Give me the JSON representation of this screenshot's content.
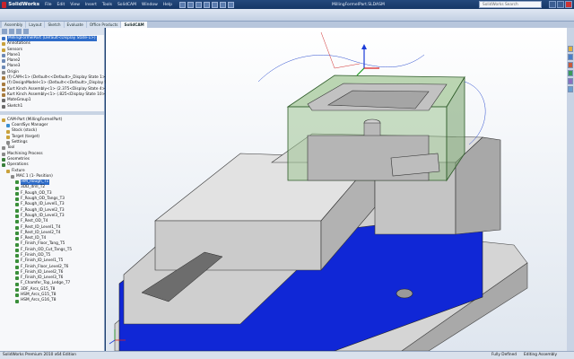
{
  "app": {
    "brand": "SolidWorks",
    "menu": [
      "File",
      "Edit",
      "View",
      "Insert",
      "Tools",
      "SolidCAM",
      "Window",
      "Help"
    ],
    "doc_title": "MillingFormelPart.SLDASM",
    "search_placeholder": "SolidWorks Search"
  },
  "tabs": [
    "Assembly",
    "Layout",
    "Sketch",
    "Evaluate",
    "Office Products",
    "SolidCAM"
  ],
  "feature_tree": [
    {
      "label": "MillingFormelPart (Default<Display State-1>)",
      "selected": true,
      "color": "#3a6fc1"
    },
    {
      "label": "Annotations",
      "color": "#c9a13b"
    },
    {
      "label": "Sensors",
      "color": "#c9a13b"
    },
    {
      "label": "Plane1",
      "color": "#6d89b5"
    },
    {
      "label": "Plane2",
      "color": "#6d89b5"
    },
    {
      "label": "Plane3",
      "color": "#6d89b5"
    },
    {
      "label": "Origin",
      "color": "#8a8a8a"
    },
    {
      "label": "(f) CAM<1> (Default<<Default>_Display State 1>)",
      "color": "#a77b3e"
    },
    {
      "label": "(f) DesignModel<1> (Default<<Default>_Display State-1>)",
      "color": "#a77b3e"
    },
    {
      "label": "Kurt Kinch Assembly<1> (2.375<Display State 4>)",
      "color": "#a77b3e"
    },
    {
      "label": "Kurt Kinch Assembly<1> (.825<Display State 10>)",
      "color": "#a77b3e"
    },
    {
      "label": "MateGroup1",
      "color": "#6b6b6b"
    },
    {
      "label": "Sketch1",
      "color": "#6b6b6b"
    }
  ],
  "cam_tree": [
    {
      "label": "CAM-Part (MillingFormelPart)",
      "color": "#c9a13b",
      "indent": 0
    },
    {
      "label": "CoordSys Manager",
      "color": "#3a8fd1",
      "indent": 1
    },
    {
      "label": "Stock (stock)",
      "color": "#c9a13b",
      "indent": 1
    },
    {
      "label": "Target (target)",
      "color": "#c9a13b",
      "indent": 1
    },
    {
      "label": "Settings",
      "color": "#8a8a8a",
      "indent": 1
    },
    {
      "label": "Tool",
      "color": "#8a8a8a",
      "indent": 0
    },
    {
      "label": "Machining Process",
      "color": "#8a8a8a",
      "indent": 0
    },
    {
      "label": "Geometries",
      "color": "#3a7f3a",
      "indent": 0
    },
    {
      "label": "Operations",
      "color": "#3a7f3a",
      "indent": 0
    },
    {
      "label": "Fixture",
      "color": "#c9a13b",
      "indent": 1
    },
    {
      "label": "MAC 1 (1- Position)",
      "color": "#8a8a8a",
      "indent": 2
    },
    {
      "label": "HM_Rough_T1",
      "color": "#3a8f3a",
      "indent": 3,
      "selected": true
    },
    {
      "label": "3DD_drill_T2",
      "color": "#3a8f3a",
      "indent": 3
    },
    {
      "label": "F_Rough_OD_T3",
      "color": "#3a8f3a",
      "indent": 3
    },
    {
      "label": "F_Rough_OD_Tangs_T3",
      "color": "#3a8f3a",
      "indent": 3
    },
    {
      "label": "F_Rough_ID_Level1_T3",
      "color": "#3a8f3a",
      "indent": 3
    },
    {
      "label": "F_Rough_ID_Level2_T3",
      "color": "#3a8f3a",
      "indent": 3
    },
    {
      "label": "F_Rough_ID_Level3_T3",
      "color": "#3a8f3a",
      "indent": 3
    },
    {
      "label": "F_Rest_OD_T4",
      "color": "#3a8f3a",
      "indent": 3
    },
    {
      "label": "F_Rest_ID_Level1_T4",
      "color": "#3a8f3a",
      "indent": 3
    },
    {
      "label": "F_Rest_ID_Level2_T4",
      "color": "#3a8f3a",
      "indent": 3
    },
    {
      "label": "F_Rest_ID_T4",
      "color": "#3a8f3a",
      "indent": 3
    },
    {
      "label": "F_Finish_Floor_Tang_T5",
      "color": "#3a8f3a",
      "indent": 3
    },
    {
      "label": "F_Finish_OD_Cut_Tangs_T5",
      "color": "#3a8f3a",
      "indent": 3
    },
    {
      "label": "F_Finish_OD_T5",
      "color": "#3a8f3a",
      "indent": 3
    },
    {
      "label": "F_Finish_ID_Level1_T5",
      "color": "#3a8f3a",
      "indent": 3
    },
    {
      "label": "F_Finish_Floor_Level2_T6",
      "color": "#3a8f3a",
      "indent": 3
    },
    {
      "label": "F_Finish_ID_Level2_T6",
      "color": "#3a8f3a",
      "indent": 3
    },
    {
      "label": "F_Finish_ID_Level3_T6",
      "color": "#3a8f3a",
      "indent": 3
    },
    {
      "label": "F_Chamfer_Top_Ledge_T7",
      "color": "#3a8f3a",
      "indent": 3
    },
    {
      "label": "3DF_Arcs_G15_T8",
      "color": "#3a8f3a",
      "indent": 3
    },
    {
      "label": "HSM_Arcs_G15_T8",
      "color": "#3a8f3a",
      "indent": 3
    },
    {
      "label": "HSM_Arcs_G16_T8",
      "color": "#3a8f3a",
      "indent": 3
    }
  ],
  "status": {
    "left": "SolidWorks Premium 2010 x64 Edition",
    "right1": "Fully Defined",
    "right2": "Editing Assembly"
  },
  "colors": {
    "vise_blue": "#1027d6",
    "vise_gray": "#c9c9c9",
    "part_green": "#9fc493"
  }
}
